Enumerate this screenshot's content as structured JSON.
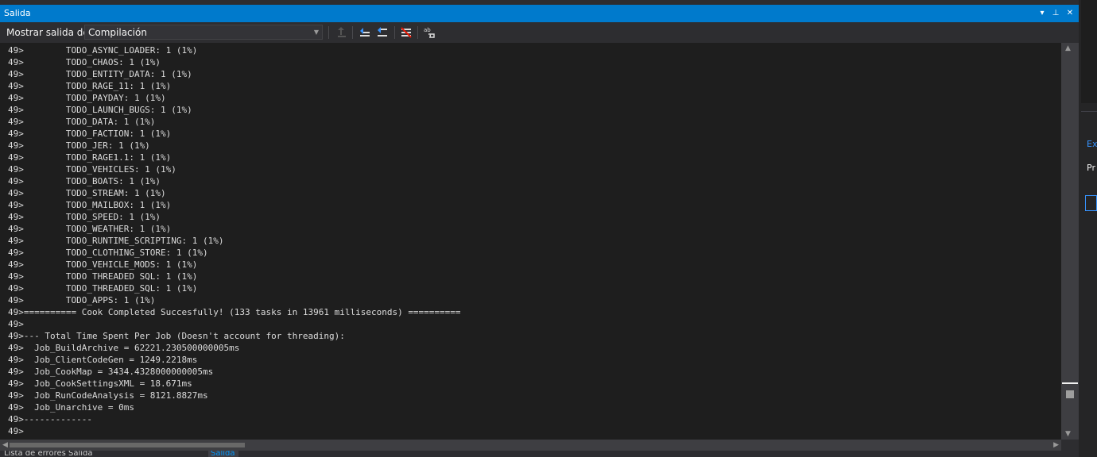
{
  "window": {
    "title": "Salida",
    "buttons": {
      "dropdown": "▾",
      "pin": "⊥",
      "close": "✕"
    }
  },
  "toolbar": {
    "label": "Mostrar salida de:",
    "source": "Compilación",
    "icons": [
      "go-to-prev-message-icon",
      "find-prev-icon",
      "find-next-icon",
      "clear-all-icon",
      "toggle-word-wrap-icon"
    ]
  },
  "output": {
    "lines": [
      "49>        TODO_ASYNC_LOADER: 1 (1%)",
      "49>        TODO_CHAOS: 1 (1%)",
      "49>        TODO_ENTITY_DATA: 1 (1%)",
      "49>        TODO_RAGE_11: 1 (1%)",
      "49>        TODO_PAYDAY: 1 (1%)",
      "49>        TODO_LAUNCH_BUGS: 1 (1%)",
      "49>        TODO_DATA: 1 (1%)",
      "49>        TODO_FACTION: 1 (1%)",
      "49>        TODO_JER: 1 (1%)",
      "49>        TODO_RAGE1.1: 1 (1%)",
      "49>        TODO_VEHICLES: 1 (1%)",
      "49>        TODO_BOATS: 1 (1%)",
      "49>        TODO_STREAM: 1 (1%)",
      "49>        TODO_MAILBOX: 1 (1%)",
      "49>        TODO_SPEED: 1 (1%)",
      "49>        TODO_WEATHER: 1 (1%)",
      "49>        TODO_RUNTIME_SCRIPTING: 1 (1%)",
      "49>        TODO_CLOTHING_STORE: 1 (1%)",
      "49>        TODO_VEHICLE_MODS: 1 (1%)",
      "49>        TODO THREADED SQL: 1 (1%)",
      "49>        TODO_THREADED_SQL: 1 (1%)",
      "49>        TODO_APPS: 1 (1%)",
      "49>========== Cook Completed Succesfully! (133 tasks in 13961 milliseconds) ==========",
      "49>",
      "49>--- Total Time Spent Per Job (Doesn't account for threading):",
      "49>  Job_BuildArchive = 62221.230500000005ms",
      "49>  Job_ClientCodeGen = 1249.2218ms",
      "49>  Job_CookMap = 3434.4328000000005ms",
      "49>  Job_CookSettingsXML = 18.671ms",
      "49>  Job_RunCodeAnalysis = 8121.8827ms",
      "49>  Job_Unarchive = 0ms",
      "49>-------------",
      "49>"
    ]
  },
  "bottom_tabs": {
    "tab1": "Lista de errores  Salida",
    "tab2": "Salida"
  },
  "right_panel": {
    "label1": "Ex",
    "label2": "Pr"
  }
}
